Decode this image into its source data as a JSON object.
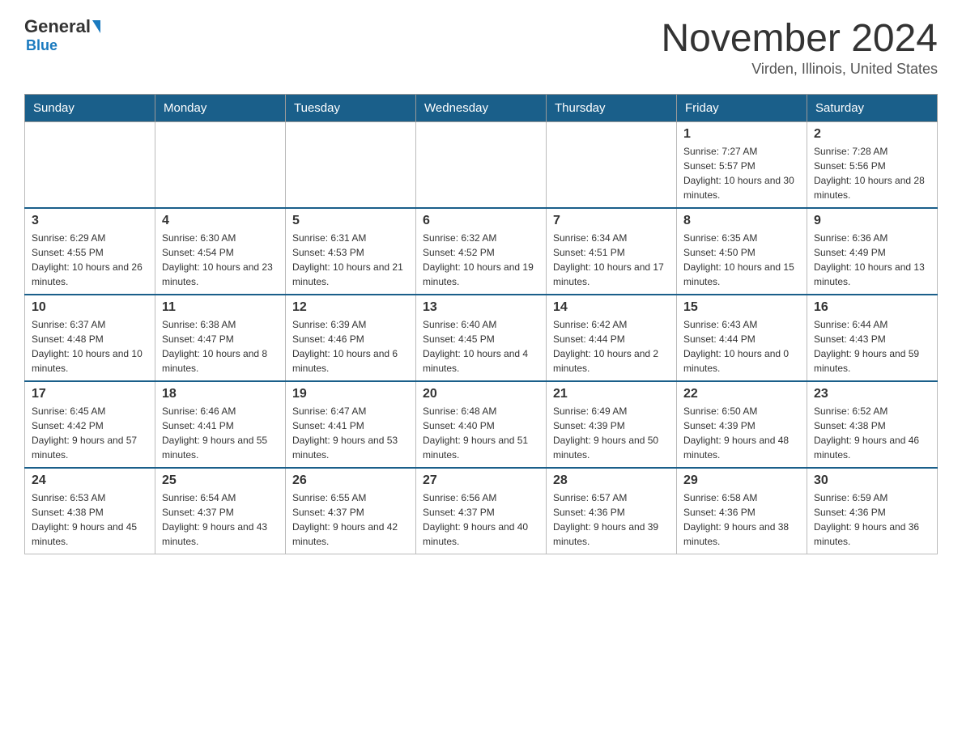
{
  "header": {
    "logo_general": "General",
    "logo_blue": "Blue",
    "month_title": "November 2024",
    "location": "Virden, Illinois, United States"
  },
  "days_of_week": [
    "Sunday",
    "Monday",
    "Tuesday",
    "Wednesday",
    "Thursday",
    "Friday",
    "Saturday"
  ],
  "weeks": [
    [
      {
        "day": "",
        "info": ""
      },
      {
        "day": "",
        "info": ""
      },
      {
        "day": "",
        "info": ""
      },
      {
        "day": "",
        "info": ""
      },
      {
        "day": "",
        "info": ""
      },
      {
        "day": "1",
        "info": "Sunrise: 7:27 AM\nSunset: 5:57 PM\nDaylight: 10 hours and 30 minutes."
      },
      {
        "day": "2",
        "info": "Sunrise: 7:28 AM\nSunset: 5:56 PM\nDaylight: 10 hours and 28 minutes."
      }
    ],
    [
      {
        "day": "3",
        "info": "Sunrise: 6:29 AM\nSunset: 4:55 PM\nDaylight: 10 hours and 26 minutes."
      },
      {
        "day": "4",
        "info": "Sunrise: 6:30 AM\nSunset: 4:54 PM\nDaylight: 10 hours and 23 minutes."
      },
      {
        "day": "5",
        "info": "Sunrise: 6:31 AM\nSunset: 4:53 PM\nDaylight: 10 hours and 21 minutes."
      },
      {
        "day": "6",
        "info": "Sunrise: 6:32 AM\nSunset: 4:52 PM\nDaylight: 10 hours and 19 minutes."
      },
      {
        "day": "7",
        "info": "Sunrise: 6:34 AM\nSunset: 4:51 PM\nDaylight: 10 hours and 17 minutes."
      },
      {
        "day": "8",
        "info": "Sunrise: 6:35 AM\nSunset: 4:50 PM\nDaylight: 10 hours and 15 minutes."
      },
      {
        "day": "9",
        "info": "Sunrise: 6:36 AM\nSunset: 4:49 PM\nDaylight: 10 hours and 13 minutes."
      }
    ],
    [
      {
        "day": "10",
        "info": "Sunrise: 6:37 AM\nSunset: 4:48 PM\nDaylight: 10 hours and 10 minutes."
      },
      {
        "day": "11",
        "info": "Sunrise: 6:38 AM\nSunset: 4:47 PM\nDaylight: 10 hours and 8 minutes."
      },
      {
        "day": "12",
        "info": "Sunrise: 6:39 AM\nSunset: 4:46 PM\nDaylight: 10 hours and 6 minutes."
      },
      {
        "day": "13",
        "info": "Sunrise: 6:40 AM\nSunset: 4:45 PM\nDaylight: 10 hours and 4 minutes."
      },
      {
        "day": "14",
        "info": "Sunrise: 6:42 AM\nSunset: 4:44 PM\nDaylight: 10 hours and 2 minutes."
      },
      {
        "day": "15",
        "info": "Sunrise: 6:43 AM\nSunset: 4:44 PM\nDaylight: 10 hours and 0 minutes."
      },
      {
        "day": "16",
        "info": "Sunrise: 6:44 AM\nSunset: 4:43 PM\nDaylight: 9 hours and 59 minutes."
      }
    ],
    [
      {
        "day": "17",
        "info": "Sunrise: 6:45 AM\nSunset: 4:42 PM\nDaylight: 9 hours and 57 minutes."
      },
      {
        "day": "18",
        "info": "Sunrise: 6:46 AM\nSunset: 4:41 PM\nDaylight: 9 hours and 55 minutes."
      },
      {
        "day": "19",
        "info": "Sunrise: 6:47 AM\nSunset: 4:41 PM\nDaylight: 9 hours and 53 minutes."
      },
      {
        "day": "20",
        "info": "Sunrise: 6:48 AM\nSunset: 4:40 PM\nDaylight: 9 hours and 51 minutes."
      },
      {
        "day": "21",
        "info": "Sunrise: 6:49 AM\nSunset: 4:39 PM\nDaylight: 9 hours and 50 minutes."
      },
      {
        "day": "22",
        "info": "Sunrise: 6:50 AM\nSunset: 4:39 PM\nDaylight: 9 hours and 48 minutes."
      },
      {
        "day": "23",
        "info": "Sunrise: 6:52 AM\nSunset: 4:38 PM\nDaylight: 9 hours and 46 minutes."
      }
    ],
    [
      {
        "day": "24",
        "info": "Sunrise: 6:53 AM\nSunset: 4:38 PM\nDaylight: 9 hours and 45 minutes."
      },
      {
        "day": "25",
        "info": "Sunrise: 6:54 AM\nSunset: 4:37 PM\nDaylight: 9 hours and 43 minutes."
      },
      {
        "day": "26",
        "info": "Sunrise: 6:55 AM\nSunset: 4:37 PM\nDaylight: 9 hours and 42 minutes."
      },
      {
        "day": "27",
        "info": "Sunrise: 6:56 AM\nSunset: 4:37 PM\nDaylight: 9 hours and 40 minutes."
      },
      {
        "day": "28",
        "info": "Sunrise: 6:57 AM\nSunset: 4:36 PM\nDaylight: 9 hours and 39 minutes."
      },
      {
        "day": "29",
        "info": "Sunrise: 6:58 AM\nSunset: 4:36 PM\nDaylight: 9 hours and 38 minutes."
      },
      {
        "day": "30",
        "info": "Sunrise: 6:59 AM\nSunset: 4:36 PM\nDaylight: 9 hours and 36 minutes."
      }
    ]
  ]
}
